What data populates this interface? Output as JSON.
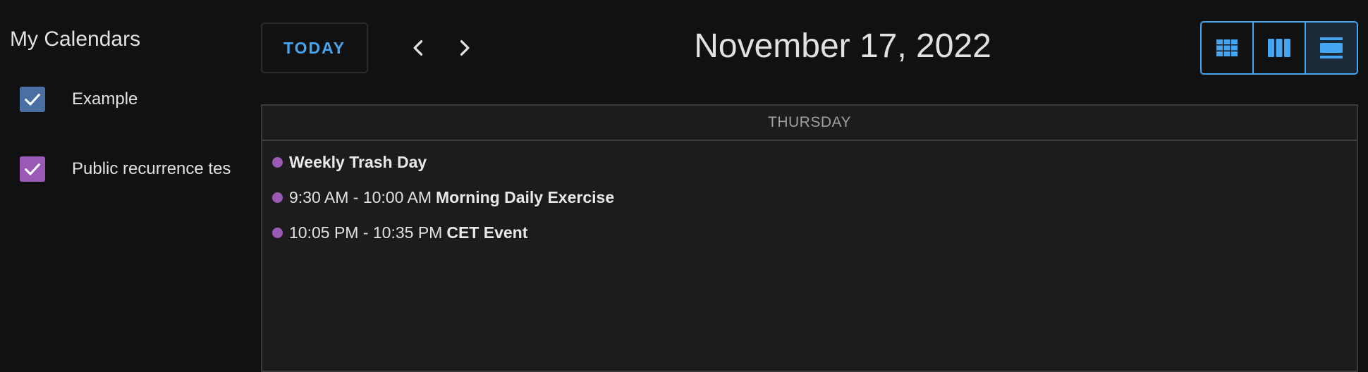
{
  "sidebar": {
    "title": "My Calendars",
    "calendars": [
      {
        "label": "Example",
        "checked": true,
        "color": "#4a6fa3"
      },
      {
        "label": "Public recurrence tes",
        "checked": true,
        "color": "#9b59b6"
      }
    ]
  },
  "toolbar": {
    "today_label": "TODAY",
    "prev_icon": "chevron-left-icon",
    "next_icon": "chevron-right-icon",
    "date_title": "November 17, 2022",
    "views": [
      {
        "icon": "month-grid-icon",
        "active": false
      },
      {
        "icon": "week-columns-icon",
        "active": false
      },
      {
        "icon": "day-list-icon",
        "active": true
      }
    ]
  },
  "day": {
    "weekday": "THURSDAY",
    "events": [
      {
        "time": "",
        "title": "Weekly Trash Day",
        "color": "#9b59b6"
      },
      {
        "time": "9:30 AM - 10:00 AM",
        "title": "Morning Daily Exercise",
        "color": "#9b59b6"
      },
      {
        "time": "10:05 PM - 10:35 PM",
        "title": "CET Event",
        "color": "#9b59b6"
      }
    ]
  },
  "colors": {
    "accent": "#44a5f3",
    "background": "#111111",
    "panel": "#1c1c1c"
  }
}
